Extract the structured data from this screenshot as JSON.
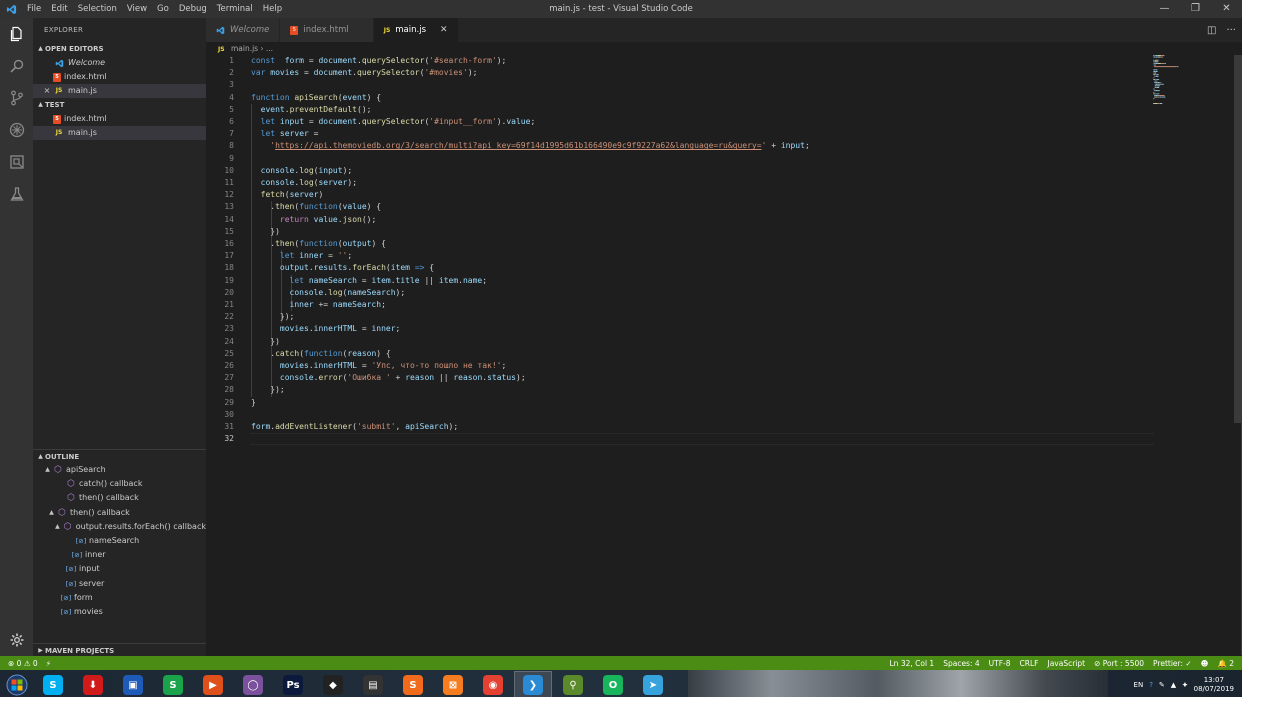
{
  "titlebar": {
    "menu": [
      "File",
      "Edit",
      "Selection",
      "View",
      "Go",
      "Debug",
      "Terminal",
      "Help"
    ],
    "window_title": "main.js - test - Visual Studio Code",
    "controls": [
      "—",
      "❐",
      "✕"
    ]
  },
  "activity_icons": [
    "files-icon",
    "search-icon",
    "source-control-icon",
    "debug-icon",
    "extensions-icon",
    "test-icon",
    "settings-gear-icon"
  ],
  "sidebar": {
    "header": "EXPLORER",
    "open_editors_label": "OPEN EDITORS",
    "open_editors": [
      {
        "label": "Welcome",
        "icon": "vscode-icon"
      },
      {
        "label": "index.html",
        "icon": "html5-icon"
      },
      {
        "label": "main.js",
        "icon": "js-icon"
      }
    ],
    "folder_label": "TEST",
    "files": [
      {
        "label": "index.html",
        "icon": "html5-icon"
      },
      {
        "label": "main.js",
        "icon": "js-icon"
      }
    ],
    "outline_label": "OUTLINE",
    "outline": [
      {
        "label": "apiSearch",
        "kind": "method",
        "twisty": "▲"
      },
      {
        "label": "catch() callback",
        "kind": "method",
        "twisty": ""
      },
      {
        "label": "then() callback",
        "kind": "method",
        "twisty": ""
      },
      {
        "label": "then() callback",
        "kind": "method",
        "twisty": "▲"
      },
      {
        "label": "output.results.forEach() callback",
        "kind": "method",
        "twisty": "▲"
      },
      {
        "label": "nameSearch",
        "kind": "variable",
        "twisty": ""
      },
      {
        "label": "inner",
        "kind": "variable",
        "twisty": ""
      },
      {
        "label": "input",
        "kind": "variable",
        "twisty": ""
      },
      {
        "label": "server",
        "kind": "variable",
        "twisty": ""
      },
      {
        "label": "form",
        "kind": "variable",
        "twisty": ""
      },
      {
        "label": "movies",
        "kind": "variable",
        "twisty": ""
      }
    ],
    "maven_label": "MAVEN PROJECTS"
  },
  "tabs": [
    {
      "label": "Welcome",
      "icon": "vscode-icon",
      "active": false
    },
    {
      "label": "index.html",
      "icon": "html5-icon",
      "active": false
    },
    {
      "label": "main.js",
      "icon": "js-icon",
      "active": true
    }
  ],
  "breadcrumb": {
    "js": "JS",
    "file": "main.js",
    "sep": "›",
    "more": "..."
  },
  "js_badge": "JS",
  "editor": {
    "current_line": 32,
    "lines": [
      [
        [
          "kw",
          "const"
        ],
        [
          "",
          "  "
        ],
        [
          "vr",
          "form"
        ],
        [
          "",
          " = "
        ],
        [
          "vr",
          "document"
        ],
        [
          "",
          "."
        ],
        [
          "fn",
          "querySelector"
        ],
        [
          "",
          "("
        ],
        [
          "st",
          "'#search-form'"
        ],
        [
          "",
          ");"
        ]
      ],
      [
        [
          "kw",
          "var"
        ],
        [
          "",
          " "
        ],
        [
          "vr",
          "movies"
        ],
        [
          "",
          " = "
        ],
        [
          "vr",
          "document"
        ],
        [
          "",
          "."
        ],
        [
          "fn",
          "querySelector"
        ],
        [
          "",
          "("
        ],
        [
          "st",
          "'#movies'"
        ],
        [
          "",
          ");"
        ]
      ],
      [],
      [
        [
          "kw",
          "function"
        ],
        [
          "",
          " "
        ],
        [
          "fn",
          "apiSearch"
        ],
        [
          "",
          "("
        ],
        [
          "vr",
          "event"
        ],
        [
          "",
          ") {"
        ]
      ],
      [
        [
          "",
          "  "
        ],
        [
          "vr",
          "event"
        ],
        [
          "",
          "."
        ],
        [
          "fn",
          "preventDefault"
        ],
        [
          "",
          "();"
        ]
      ],
      [
        [
          "",
          "  "
        ],
        [
          "kw",
          "let"
        ],
        [
          "",
          " "
        ],
        [
          "vr",
          "input"
        ],
        [
          "",
          " = "
        ],
        [
          "vr",
          "document"
        ],
        [
          "",
          "."
        ],
        [
          "fn",
          "querySelector"
        ],
        [
          "",
          "("
        ],
        [
          "st",
          "'#input__form'"
        ],
        [
          "",
          ")."
        ],
        [
          "vr",
          "value"
        ],
        [
          "",
          ";"
        ]
      ],
      [
        [
          "",
          "  "
        ],
        [
          "kw",
          "let"
        ],
        [
          "",
          " "
        ],
        [
          "vr",
          "server"
        ],
        [
          "",
          " ="
        ]
      ],
      [
        [
          "",
          "    "
        ],
        [
          "st",
          "'"
        ],
        [
          "url",
          "https://api.themoviedb.org/3/search/multi?api_key=69f14d1995d61b166490e9c9f9227a62&language=ru&query="
        ],
        [
          "st",
          "'"
        ],
        [
          "",
          " + "
        ],
        [
          "vr",
          "input"
        ],
        [
          "",
          ";"
        ]
      ],
      [],
      [
        [
          "",
          "  "
        ],
        [
          "vr",
          "console"
        ],
        [
          "",
          "."
        ],
        [
          "fn",
          "log"
        ],
        [
          "",
          "("
        ],
        [
          "vr",
          "input"
        ],
        [
          "",
          ");"
        ]
      ],
      [
        [
          "",
          "  "
        ],
        [
          "vr",
          "console"
        ],
        [
          "",
          "."
        ],
        [
          "fn",
          "log"
        ],
        [
          "",
          "("
        ],
        [
          "vr",
          "server"
        ],
        [
          "",
          ");"
        ]
      ],
      [
        [
          "",
          "  "
        ],
        [
          "fn",
          "fetch"
        ],
        [
          "",
          "("
        ],
        [
          "vr",
          "server"
        ],
        [
          "",
          ")"
        ]
      ],
      [
        [
          "",
          "    ."
        ],
        [
          "fn",
          "then"
        ],
        [
          "",
          "("
        ],
        [
          "kw",
          "function"
        ],
        [
          "",
          "("
        ],
        [
          "vr",
          "value"
        ],
        [
          "",
          ") {"
        ]
      ],
      [
        [
          "",
          "      "
        ],
        [
          "cf",
          "return"
        ],
        [
          "",
          " "
        ],
        [
          "vr",
          "value"
        ],
        [
          "",
          "."
        ],
        [
          "fn",
          "json"
        ],
        [
          "",
          "();"
        ]
      ],
      [
        [
          "",
          "    })"
        ]
      ],
      [
        [
          "",
          "    ."
        ],
        [
          "fn",
          "then"
        ],
        [
          "",
          "("
        ],
        [
          "kw",
          "function"
        ],
        [
          "",
          "("
        ],
        [
          "vr",
          "output"
        ],
        [
          "",
          ") {"
        ]
      ],
      [
        [
          "",
          "      "
        ],
        [
          "kw",
          "let"
        ],
        [
          "",
          " "
        ],
        [
          "vr",
          "inner"
        ],
        [
          "",
          " = "
        ],
        [
          "st",
          "''"
        ],
        [
          "",
          ";"
        ]
      ],
      [
        [
          "",
          "      "
        ],
        [
          "vr",
          "output"
        ],
        [
          "",
          "."
        ],
        [
          "vr",
          "results"
        ],
        [
          "",
          "."
        ],
        [
          "fn",
          "forEach"
        ],
        [
          "",
          "("
        ],
        [
          "vr",
          "item"
        ],
        [
          "",
          " "
        ],
        [
          "kw",
          "=>"
        ],
        [
          "",
          " {"
        ]
      ],
      [
        [
          "",
          "        "
        ],
        [
          "kw",
          "let"
        ],
        [
          "",
          " "
        ],
        [
          "vr",
          "nameSearch"
        ],
        [
          "",
          " = "
        ],
        [
          "vr",
          "item"
        ],
        [
          "",
          "."
        ],
        [
          "vr",
          "title"
        ],
        [
          "",
          " || "
        ],
        [
          "vr",
          "item"
        ],
        [
          "",
          "."
        ],
        [
          "vr",
          "name"
        ],
        [
          "",
          ";"
        ]
      ],
      [
        [
          "",
          "        "
        ],
        [
          "vr",
          "console"
        ],
        [
          "",
          "."
        ],
        [
          "fn",
          "log"
        ],
        [
          "",
          "("
        ],
        [
          "vr",
          "nameSearch"
        ],
        [
          "",
          ");"
        ]
      ],
      [
        [
          "",
          "        "
        ],
        [
          "vr",
          "inner"
        ],
        [
          "",
          " += "
        ],
        [
          "vr",
          "nameSearch"
        ],
        [
          "",
          ";"
        ]
      ],
      [
        [
          "",
          "      });"
        ]
      ],
      [
        [
          "",
          "      "
        ],
        [
          "vr",
          "movies"
        ],
        [
          "",
          "."
        ],
        [
          "vr",
          "innerHTML"
        ],
        [
          "",
          " = "
        ],
        [
          "vr",
          "inner"
        ],
        [
          "",
          ";"
        ]
      ],
      [
        [
          "",
          "    })"
        ]
      ],
      [
        [
          "",
          "    ."
        ],
        [
          "fn",
          "catch"
        ],
        [
          "",
          "("
        ],
        [
          "kw",
          "function"
        ],
        [
          "",
          "("
        ],
        [
          "vr",
          "reason"
        ],
        [
          "",
          ") {"
        ]
      ],
      [
        [
          "",
          "      "
        ],
        [
          "vr",
          "movies"
        ],
        [
          "",
          "."
        ],
        [
          "vr",
          "innerHTML"
        ],
        [
          "",
          " = "
        ],
        [
          "st",
          "'Упс, что-то пошло не так!'"
        ],
        [
          "",
          ";"
        ]
      ],
      [
        [
          "",
          "      "
        ],
        [
          "vr",
          "console"
        ],
        [
          "",
          "."
        ],
        [
          "fn",
          "error"
        ],
        [
          "",
          "("
        ],
        [
          "st",
          "'Ошибка '"
        ],
        [
          "",
          " + "
        ],
        [
          "vr",
          "reason"
        ],
        [
          "",
          " || "
        ],
        [
          "vr",
          "reason"
        ],
        [
          "",
          "."
        ],
        [
          "vr",
          "status"
        ],
        [
          "",
          ");"
        ]
      ],
      [
        [
          "",
          "    });"
        ]
      ],
      [
        [
          "",
          "}"
        ]
      ],
      [],
      [
        [
          "vr",
          "form"
        ],
        [
          "",
          "."
        ],
        [
          "fn",
          "addEventListener"
        ],
        [
          "",
          "("
        ],
        [
          "st",
          "'submit'"
        ],
        [
          "",
          ", "
        ],
        [
          "vr",
          "apiSearch"
        ],
        [
          "",
          ");"
        ]
      ],
      []
    ]
  },
  "statusbar": {
    "left": [
      "⊗ 0 ⚠ 0",
      "⚡"
    ],
    "right": [
      "Ln 32, Col 1",
      "Spaces: 4",
      "UTF-8",
      "CRLF",
      "JavaScript",
      "⊘ Port : 5500",
      "Prettier: ✓",
      "☻",
      "🔔 2"
    ]
  },
  "taskbar": {
    "apps": [
      {
        "name": "skype-icon",
        "glyph": "S",
        "color": "#00aff0"
      },
      {
        "name": "download-manager-icon",
        "glyph": "⬇",
        "color": "#d11a1a"
      },
      {
        "name": "floppy-save-icon",
        "glyph": "▣",
        "color": "#1e5bb8"
      },
      {
        "name": "skype-alt-icon",
        "glyph": "S",
        "color": "#1aa34a"
      },
      {
        "name": "media-app-icon",
        "glyph": "▶",
        "color": "#e0501a"
      },
      {
        "name": "viber-icon",
        "glyph": "◯",
        "color": "#7b519d"
      },
      {
        "name": "photoshop-icon",
        "glyph": "Ps",
        "color": "#0b1a3c"
      },
      {
        "name": "inkscape-icon",
        "glyph": "◆",
        "color": "#222222"
      },
      {
        "name": "clapperboard-icon",
        "glyph": "▤",
        "color": "#333333"
      },
      {
        "name": "sublime-text-icon",
        "glyph": "S",
        "color": "#f26b1d"
      },
      {
        "name": "xampp-icon",
        "glyph": "⊠",
        "color": "#f57c1f"
      },
      {
        "name": "chrome-icon",
        "glyph": "◉",
        "color": "#e44133"
      },
      {
        "name": "vscode-taskbar-icon",
        "glyph": "❯",
        "color": "#2a8ad4"
      },
      {
        "name": "green-app-icon",
        "glyph": "⚲",
        "color": "#5a8a2a"
      },
      {
        "name": "opera-icon",
        "glyph": "O",
        "color": "#18b55d"
      },
      {
        "name": "telegram-icon",
        "glyph": "➤",
        "color": "#37a3dc"
      }
    ],
    "tray_lang": "EN",
    "time": "13:07",
    "date": "08/07/2019"
  }
}
